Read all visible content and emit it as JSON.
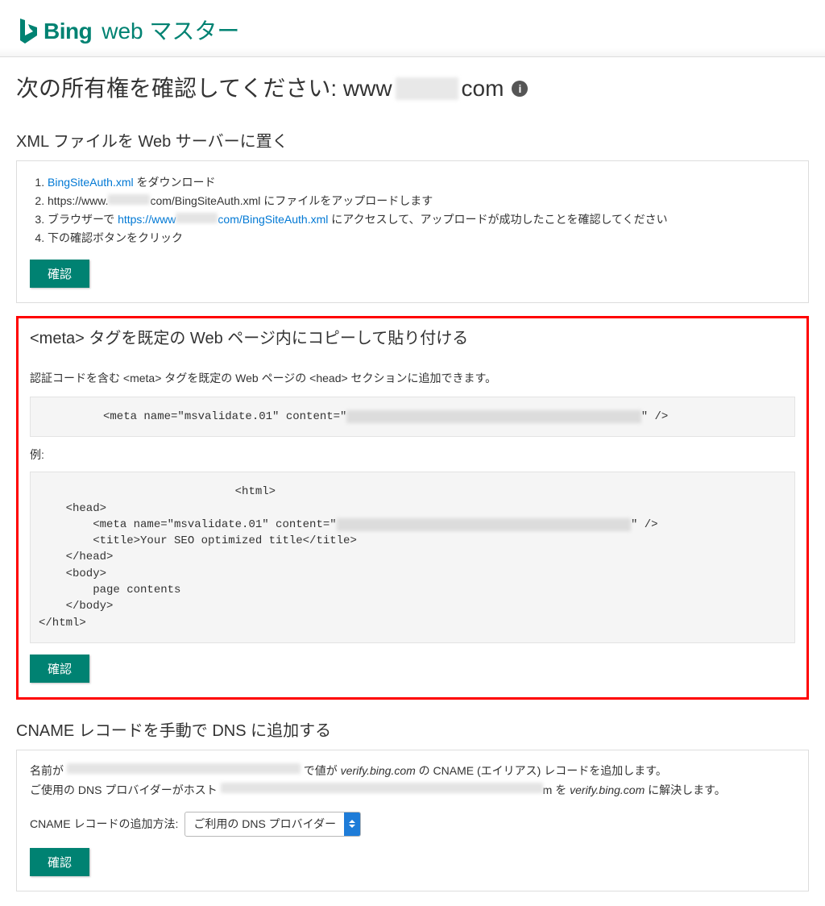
{
  "brand": {
    "name": "Bing",
    "subtitle": "web マスター"
  },
  "page_title": {
    "prefix": "次の所有権を確認してください: www",
    "redacted": "████",
    "suffix": "com"
  },
  "section_xml": {
    "title": "XML ファイルを Web サーバーに置く",
    "steps": {
      "s1_link": "BingSiteAuth.xml",
      "s1_after": " をダウンロード",
      "s2_before": "https://www.",
      "s2_after": "com/BingSiteAuth.xml にファイルをアップロードします",
      "s3_before": "ブラウザーで ",
      "s3_link_before": "https://www",
      "s3_link_after": "com/BingSiteAuth.xml",
      "s3_after": " にアクセスして、アップロードが成功したことを確認してください",
      "s4": "下の確認ボタンをクリック"
    },
    "confirm": "確認"
  },
  "section_meta": {
    "title": "<meta> タグを既定の Web ページ内にコピーして貼り付ける",
    "desc": "認証コードを含む <meta> タグを既定の Web ページの <head> セクションに追加できます。",
    "snippet_before": "<meta name=\"msvalidate.01\" content=\"",
    "snippet_blur": "5██████████████████████████████████████████",
    "snippet_after": "\" />",
    "example_label": "例:",
    "example_lines": {
      "l1": "                             <html>",
      "l2": "    <head>",
      "l3a": "        <meta name=\"msvalidate.01\" content=\"",
      "l3_blur": "1██████████████████████████████████████████",
      "l3b": "\" />",
      "l4": "        <title>Your SEO optimized title</title>",
      "l5": "    </head>",
      "l6": "    <body>",
      "l7": "        page contents",
      "l8": "    </body>",
      "l9": "</html>"
    },
    "confirm": "確認"
  },
  "section_cname": {
    "title": "CNAME レコードを手動で DNS に追加する",
    "line1_before": "名前が ",
    "line1_mid": " で値が ",
    "line1_verify": "verify.bing.com",
    "line1_after": " の CNAME (エイリアス) レコードを追加します。",
    "line2_before": "ご使用の DNS プロバイダーがホスト ",
    "line2_mid": "m を ",
    "line2_verify": "verify.bing.com",
    "line2_after": " に解決します。",
    "select_label": "CNAME レコードの追加方法:",
    "select_value": "ご利用の DNS プロバイダー",
    "confirm": "確認"
  }
}
